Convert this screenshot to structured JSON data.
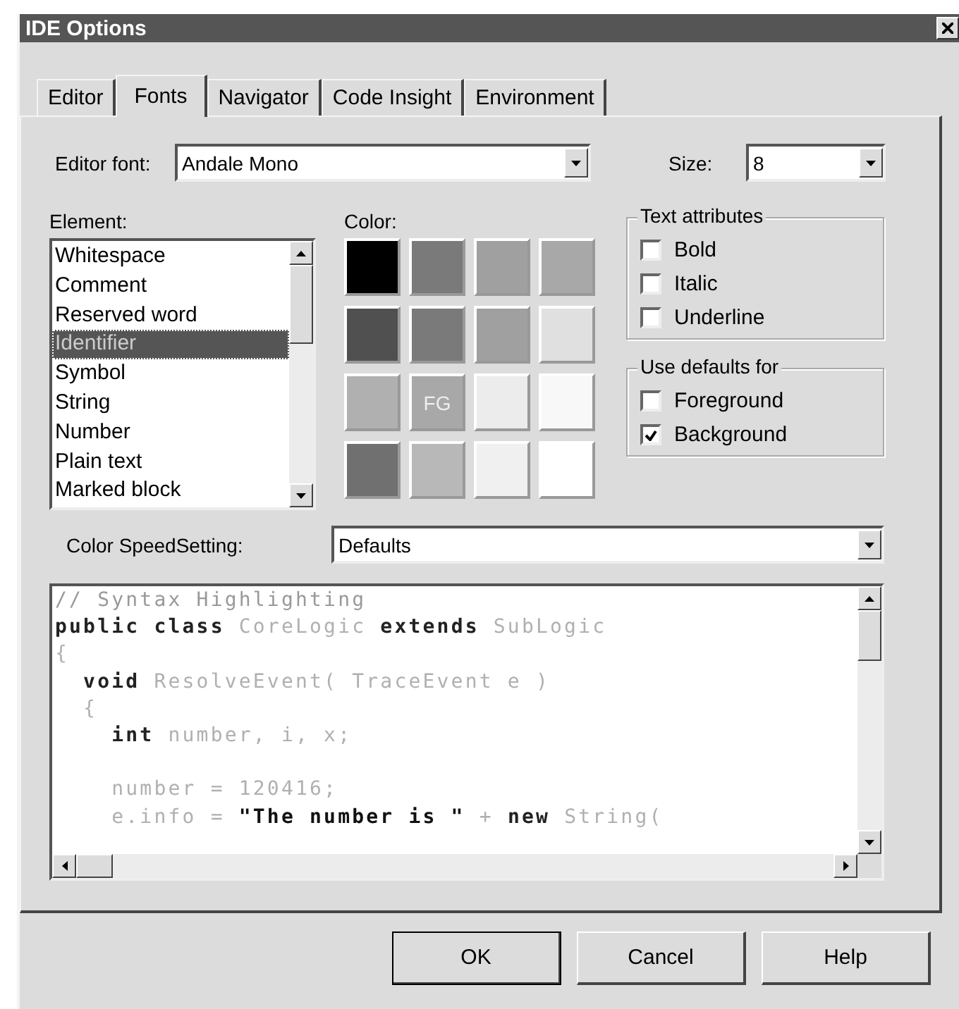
{
  "window": {
    "title": "IDE Options"
  },
  "tabs": [
    {
      "label": "Editor",
      "selected": false
    },
    {
      "label": "Fonts",
      "selected": true
    },
    {
      "label": "Navigator",
      "selected": false
    },
    {
      "label": "Code Insight",
      "selected": false
    },
    {
      "label": "Environment",
      "selected": false
    }
  ],
  "editor_font": {
    "label": "Editor font:",
    "value": "Andale Mono"
  },
  "size": {
    "label": "Size:",
    "value": "8"
  },
  "element": {
    "label": "Element:",
    "items": [
      {
        "label": "Whitespace",
        "selected": false
      },
      {
        "label": "Comment",
        "selected": false
      },
      {
        "label": "Reserved word",
        "selected": false
      },
      {
        "label": "Identifier",
        "selected": true
      },
      {
        "label": "Symbol",
        "selected": false
      },
      {
        "label": "String",
        "selected": false
      },
      {
        "label": "Number",
        "selected": false
      },
      {
        "label": "Plain text",
        "selected": false
      },
      {
        "label": "Marked block",
        "selected": false
      }
    ]
  },
  "color": {
    "label": "Color:",
    "swatches": [
      {
        "color": "#000000"
      },
      {
        "color": "#7a7a7a"
      },
      {
        "color": "#a0a0a0"
      },
      {
        "color": "#a8a8a8"
      },
      {
        "color": "#505050"
      },
      {
        "color": "#7a7a7a"
      },
      {
        "color": "#a0a0a0"
      },
      {
        "color": "#e0e0e0"
      },
      {
        "color": "#b0b0b0"
      },
      {
        "color": "#a8a8a8",
        "label": "FG"
      },
      {
        "color": "#ececec"
      },
      {
        "color": "#f8f8f8"
      },
      {
        "color": "#707070"
      },
      {
        "color": "#b8b8b8"
      },
      {
        "color": "#f0f0f0"
      },
      {
        "color": "#ffffff"
      }
    ]
  },
  "text_attributes": {
    "title": "Text attributes",
    "options": [
      {
        "label": "Bold",
        "checked": false
      },
      {
        "label": "Italic",
        "checked": false
      },
      {
        "label": "Underline",
        "checked": false
      }
    ]
  },
  "use_defaults": {
    "title": "Use defaults for",
    "options": [
      {
        "label": "Foreground",
        "checked": false
      },
      {
        "label": "Background",
        "checked": true
      }
    ]
  },
  "color_speed_setting": {
    "label": "Color SpeedSetting:",
    "value": "Defaults"
  },
  "code_preview": {
    "lines": [
      {
        "kind": "code",
        "tokens": [
          {
            "kind": "comment",
            "text": "// Syntax Highlighting"
          }
        ]
      },
      {
        "kind": "code",
        "tokens": [
          {
            "kind": "keyword",
            "text": "public class "
          },
          {
            "kind": "identifier",
            "text": "CoreLogic "
          },
          {
            "kind": "keyword",
            "text": "extends "
          },
          {
            "kind": "identifier",
            "text": "SubLogic"
          }
        ]
      },
      {
        "kind": "code",
        "tokens": [
          {
            "kind": "symbol",
            "text": "{"
          }
        ]
      },
      {
        "kind": "code",
        "tokens": [
          {
            "kind": "keyword",
            "text": "  void "
          },
          {
            "kind": "identifier",
            "text": "ResolveEvent( TraceEvent e )"
          }
        ]
      },
      {
        "kind": "code",
        "tokens": [
          {
            "kind": "symbol",
            "text": "  {"
          }
        ]
      },
      {
        "kind": "code",
        "tokens": [
          {
            "kind": "keyword",
            "text": "    int "
          },
          {
            "kind": "identifier",
            "text": "number, i, x;"
          }
        ]
      },
      {
        "kind": "blank"
      },
      {
        "kind": "code",
        "tokens": [
          {
            "kind": "identifier",
            "text": "    number = 120416;"
          }
        ]
      },
      {
        "kind": "code",
        "tokens": [
          {
            "kind": "identifier",
            "text": "    e.info = "
          },
          {
            "kind": "string",
            "text": "\"The number is \""
          },
          {
            "kind": "identifier",
            "text": " + "
          },
          {
            "kind": "keyword",
            "text": "new "
          },
          {
            "kind": "identifier",
            "text": "String("
          }
        ]
      }
    ]
  },
  "buttons": [
    {
      "label": "OK",
      "default": true
    },
    {
      "label": "Cancel",
      "default": false
    },
    {
      "label": "Help",
      "default": false
    }
  ]
}
